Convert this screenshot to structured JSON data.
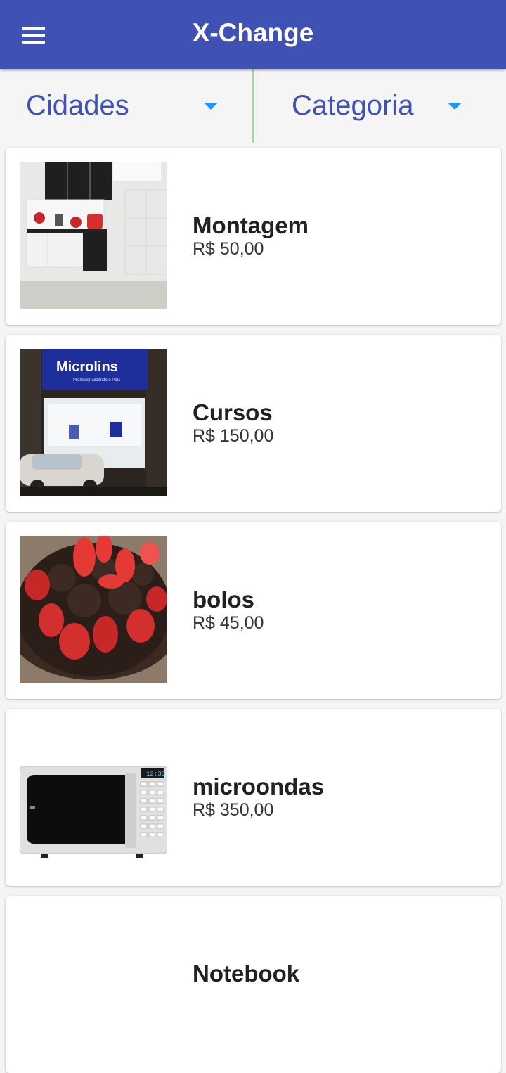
{
  "app": {
    "title": "X-Change"
  },
  "filters": {
    "cities_label": "Cidades",
    "category_label": "Categoria"
  },
  "items": [
    {
      "title": "Montagem",
      "price": "R$ 50,00"
    },
    {
      "title": "Cursos",
      "price": "R$ 150,00"
    },
    {
      "title": "bolos",
      "price": "R$ 45,00"
    },
    {
      "title": "microondas",
      "price": "R$ 350,00"
    },
    {
      "title": "Notebook",
      "price": ""
    }
  ],
  "images": {
    "item0": "kitchen-cabinet-photo",
    "item1": "storefront-photo",
    "item2": "chocolate-strawberry-cake-photo",
    "item3": "microwave-photo"
  },
  "colors": {
    "primary": "#3f51b5",
    "accent": "#2196f3",
    "divider": "#a5d6a7"
  },
  "storefront_sign": {
    "brand": "Microlins",
    "tagline": "Profissionalizando o País"
  },
  "microwave_display": "12:30"
}
